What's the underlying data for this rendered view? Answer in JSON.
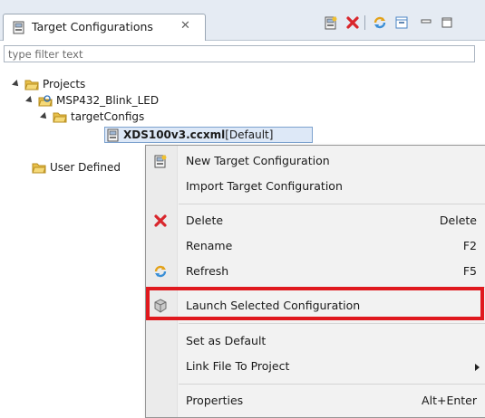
{
  "view": {
    "tab_title": "Target Configurations",
    "tab_close": "✕",
    "toolbar": [
      "new-config-icon",
      "delete-icon",
      "refresh-icon",
      "collapse-all-icon",
      "minimize-icon",
      "maximize-icon"
    ]
  },
  "filter": {
    "placeholder": "type filter text"
  },
  "tree": {
    "projects": "Projects",
    "project": "MSP432_Blink_LED",
    "folder": "targetConfigs",
    "selected_file_bold": "XDS100v3.ccxml",
    "selected_file_suffix": " [Default]",
    "user_defined": "User Defined"
  },
  "menu": {
    "items": [
      {
        "label": "New Target Configuration",
        "accel": ""
      },
      {
        "label": "Import Target Configuration",
        "accel": ""
      },
      {
        "label": "Delete",
        "accel": "Delete"
      },
      {
        "label": "Rename",
        "accel": "F2"
      },
      {
        "label": "Refresh",
        "accel": "F5"
      },
      {
        "label": "Launch Selected Configuration",
        "accel": ""
      },
      {
        "label": "Set as Default",
        "accel": ""
      },
      {
        "label": "Link File To Project",
        "accel": ""
      },
      {
        "label": "Properties",
        "accel": "Alt+Enter"
      }
    ]
  },
  "colors": {
    "highlight": "#e0191e",
    "tab_bar": "#e5ebf3",
    "folder": "#e8c04a",
    "delete_x": "#d9262c"
  }
}
